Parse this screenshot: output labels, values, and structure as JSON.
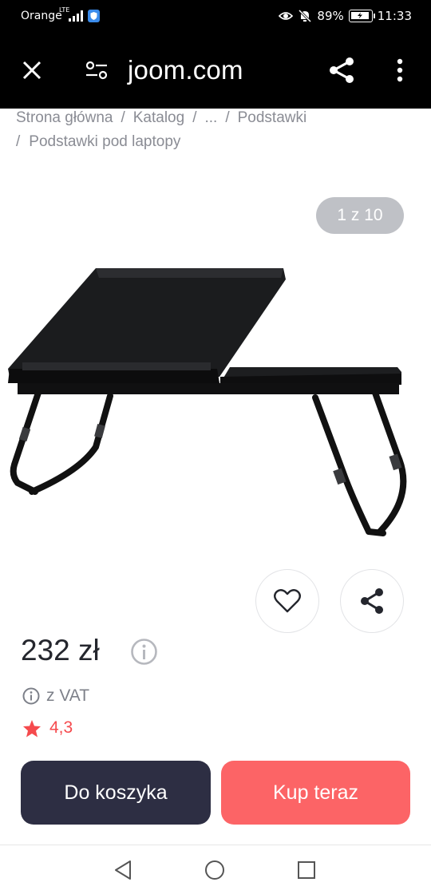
{
  "status_bar": {
    "carrier": "Orange",
    "network": "LTE",
    "battery": "89%",
    "time": "11:33"
  },
  "app_bar": {
    "url": "joom.com",
    "icons": [
      "close-icon",
      "site-settings-icon",
      "share-icon",
      "more-vert-icon"
    ]
  },
  "breadcrumb": {
    "items": [
      "Strona główna",
      "Katalog",
      "...",
      "Podstawki"
    ],
    "current": "Podstawki pod laptopy",
    "separator": "/"
  },
  "gallery": {
    "counter": "1 z 10"
  },
  "product": {
    "price": "232 zł",
    "vat": "z VAT",
    "rating": "4,3"
  },
  "actions": {
    "add_to_cart": "Do koszyka",
    "buy_now": "Kup teraz"
  },
  "colors": {
    "cart_button": "#2d2e43",
    "buy_button": "#fc6466",
    "rating": "#f54a4d"
  }
}
